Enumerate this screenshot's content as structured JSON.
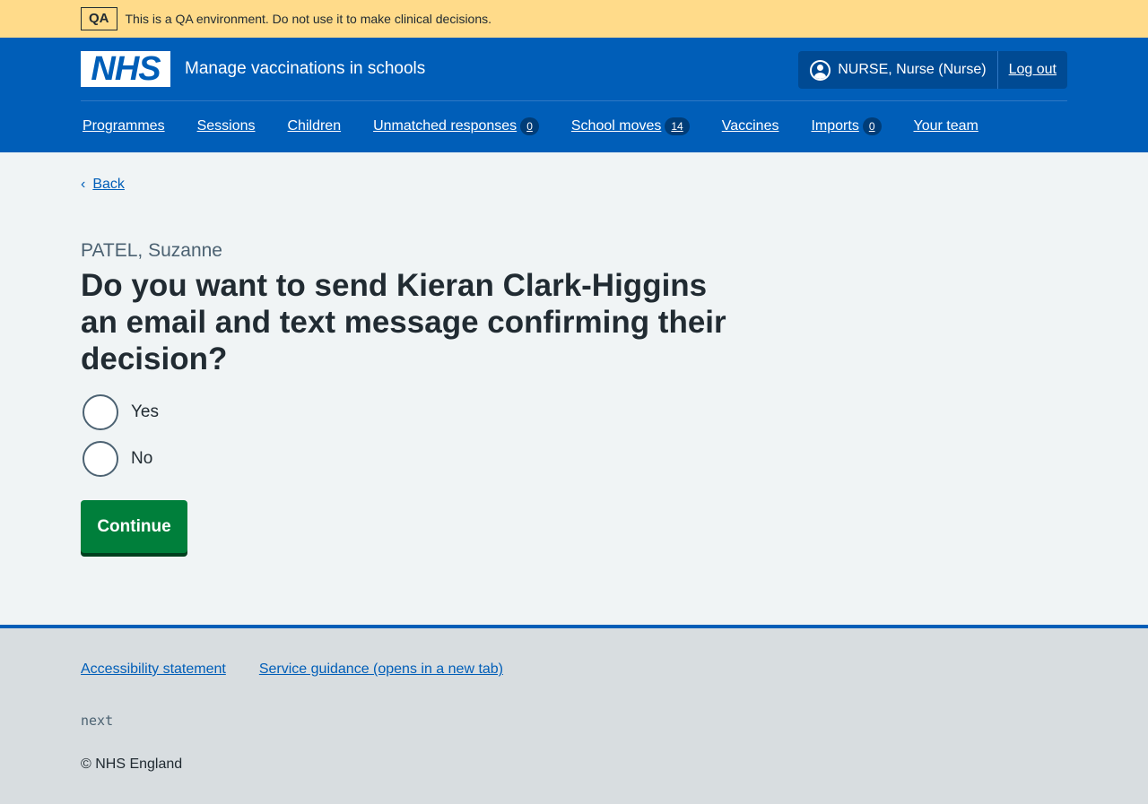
{
  "qa_banner": {
    "tag": "QA",
    "message": "This is a QA environment. Do not use it to make clinical decisions."
  },
  "header": {
    "logo_text": "NHS",
    "service_name": "Manage vaccinations in schools",
    "account": {
      "user": "NURSE, Nurse (Nurse)",
      "logout_label": "Log out"
    },
    "nav": [
      {
        "label": "Programmes",
        "badge": null
      },
      {
        "label": "Sessions",
        "badge": null
      },
      {
        "label": "Children",
        "badge": null
      },
      {
        "label": "Unmatched responses",
        "badge": "0"
      },
      {
        "label": "School moves",
        "badge": "14"
      },
      {
        "label": "Vaccines",
        "badge": null
      },
      {
        "label": "Imports",
        "badge": "0"
      },
      {
        "label": "Your team",
        "badge": null
      }
    ]
  },
  "main": {
    "back_label": "Back",
    "caption": "PATEL, Suzanne",
    "question": "Do you want to send Kieran Clark-Higgins an email and text message confirming their decision?",
    "options": [
      "Yes",
      "No"
    ],
    "continue_label": "Continue"
  },
  "footer": {
    "links": [
      "Accessibility statement",
      "Service guidance (opens in a new tab)"
    ],
    "environment": "next",
    "copyright": "© NHS England"
  },
  "colors": {
    "header_blue": "#005eb8",
    "qa_banner": "#ffdb8a",
    "button_green": "#007f3b",
    "page_bg": "#f0f4f5",
    "footer_bg": "#d8dde0"
  }
}
